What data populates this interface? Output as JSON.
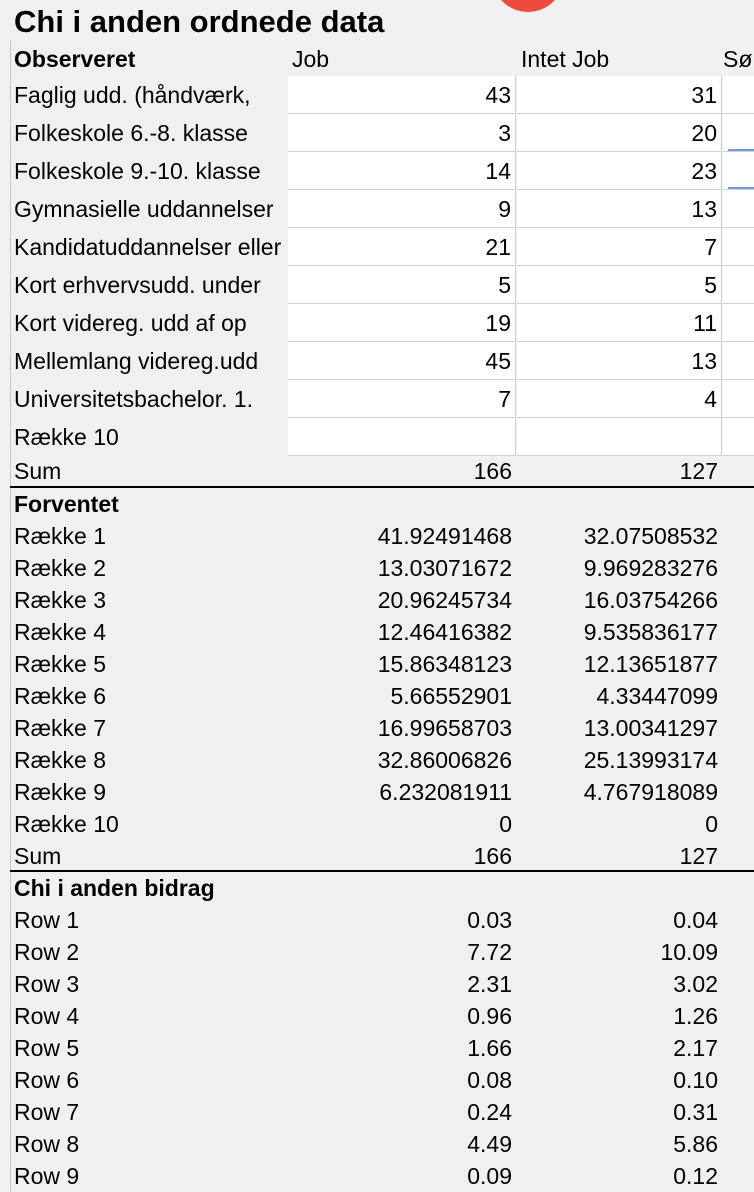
{
  "title": "Chi i anden ordnede data",
  "logo_icon": "red-play-logo-icon",
  "observed": {
    "header": {
      "label": "Observeret",
      "col1": "Job",
      "col2": "Intet Job",
      "col3": "Sø"
    },
    "rows": [
      {
        "label": "Faglig udd. (håndværk,",
        "v1": "43",
        "v2": "31"
      },
      {
        "label": "Folkeskole 6.-8. klasse",
        "v1": "3",
        "v2": "20"
      },
      {
        "label": "Folkeskole 9.-10. klasse",
        "v1": "14",
        "v2": "23"
      },
      {
        "label": "Gymnasielle uddannelser",
        "v1": "9",
        "v2": "13"
      },
      {
        "label": "Kandidatuddannelser eller",
        "v1": "21",
        "v2": "7"
      },
      {
        "label": "Kort erhvervsudd. under",
        "v1": "5",
        "v2": "5"
      },
      {
        "label": "Kort videreg. udd af op",
        "v1": "19",
        "v2": "11"
      },
      {
        "label": "Mellemlang videreg.udd",
        "v1": "45",
        "v2": "13"
      },
      {
        "label": "Universitetsbachelor. 1.",
        "v1": "7",
        "v2": "4"
      },
      {
        "label": "Række 10",
        "v1": "",
        "v2": ""
      }
    ],
    "sum": {
      "label": "Sum",
      "v1": "166",
      "v2": "127"
    }
  },
  "expected": {
    "header": "Forventet",
    "rows": [
      {
        "label": "Række 1",
        "v1": "41.92491468",
        "v2": "32.07508532"
      },
      {
        "label": "Række 2",
        "v1": "13.03071672",
        "v2": "9.969283276"
      },
      {
        "label": "Række 3",
        "v1": "20.96245734",
        "v2": "16.03754266"
      },
      {
        "label": "Række 4",
        "v1": "12.46416382",
        "v2": "9.535836177"
      },
      {
        "label": "Række 5",
        "v1": "15.86348123",
        "v2": "12.13651877"
      },
      {
        "label": "Række 6",
        "v1": "5.66552901",
        "v2": "4.33447099"
      },
      {
        "label": "Række 7",
        "v1": "16.99658703",
        "v2": "13.00341297"
      },
      {
        "label": "Række 8",
        "v1": "32.86006826",
        "v2": "25.13993174"
      },
      {
        "label": "Række 9",
        "v1": "6.232081911",
        "v2": "4.767918089"
      },
      {
        "label": "Række 10",
        "v1": "0",
        "v2": "0"
      }
    ],
    "sum": {
      "label": "Sum",
      "v1": "166",
      "v2": "127"
    }
  },
  "contribution": {
    "header": "Chi i anden bidrag",
    "rows": [
      {
        "label": "Row 1",
        "v1": "0.03",
        "v2": "0.04"
      },
      {
        "label": "Row 2",
        "v1": "7.72",
        "v2": "10.09"
      },
      {
        "label": "Row 3",
        "v1": "2.31",
        "v2": "3.02"
      },
      {
        "label": "Row 4",
        "v1": "0.96",
        "v2": "1.26"
      },
      {
        "label": "Row 5",
        "v1": "1.66",
        "v2": "2.17"
      },
      {
        "label": "Row 6",
        "v1": "0.08",
        "v2": "0.10"
      },
      {
        "label": "Row 7",
        "v1": "0.24",
        "v2": "0.31"
      },
      {
        "label": "Row 8",
        "v1": "4.49",
        "v2": "5.86"
      },
      {
        "label": "Row 9",
        "v1": "0.09",
        "v2": "0.12"
      }
    ]
  }
}
